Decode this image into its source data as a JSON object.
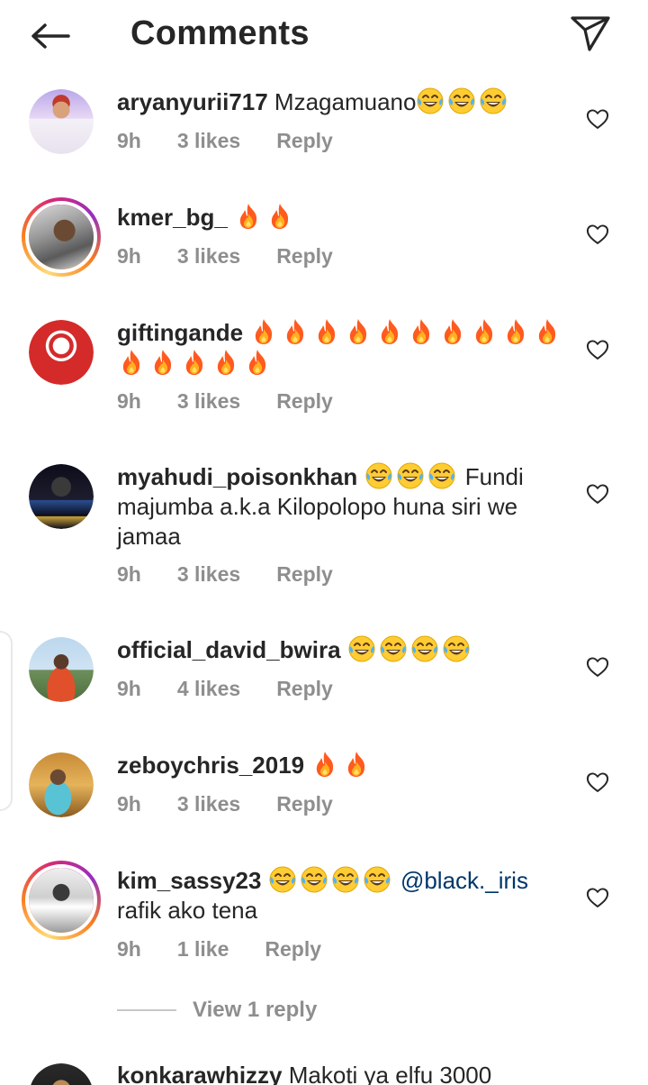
{
  "header": {
    "title": "Comments",
    "back_icon": "arrow-left-icon",
    "share_icon": "send-icon"
  },
  "comments": [
    {
      "username": "aryanyurii717",
      "text": "Mzagamuano",
      "emoji_count": 3,
      "emoji": "laughing-tears-emoji",
      "time": "9h",
      "likes": "3 likes",
      "reply": "Reply"
    },
    {
      "username": "kmer_bg_",
      "text": "",
      "emoji_count": 2,
      "emoji": "fire-emoji",
      "time": "9h",
      "likes": "3 likes",
      "reply": "Reply"
    },
    {
      "username": "giftingande",
      "text": "",
      "emoji_count": 15,
      "emoji": "fire-emoji",
      "time": "9h",
      "likes": "3 likes",
      "reply": "Reply"
    },
    {
      "username": "myahudi_poisonkhan",
      "text": "Fundi majumba a.k.a Kilopolopo huna siri we jamaa",
      "emoji_count": 3,
      "emoji": "laughing-tears-emoji",
      "time": "9h",
      "likes": "3 likes",
      "reply": "Reply"
    },
    {
      "username": "official_david_bwira",
      "text": "",
      "emoji_count": 4,
      "emoji": "laughing-tears-emoji",
      "time": "9h",
      "likes": "4 likes",
      "reply": "Reply"
    },
    {
      "username": "zeboychris_2019",
      "text": "",
      "emoji_count": 2,
      "emoji": "fire-emoji",
      "time": "9h",
      "likes": "3 likes",
      "reply": "Reply"
    },
    {
      "username": "kim_sassy23",
      "mention": "@black._iris",
      "text": "rafik ako tena",
      "emoji_count": 4,
      "emoji": "laughing-tears-emoji",
      "time": "9h",
      "likes": "1 like",
      "reply": "Reply"
    },
    {
      "username": "konkarawhizzy",
      "text": "Makoti ya elfu 3000"
    }
  ],
  "view_replies": "View 1 reply",
  "colors": {
    "text": "#262626",
    "meta": "#8e8e8e",
    "mention": "#00376b",
    "divider": "#c7c7c7"
  }
}
